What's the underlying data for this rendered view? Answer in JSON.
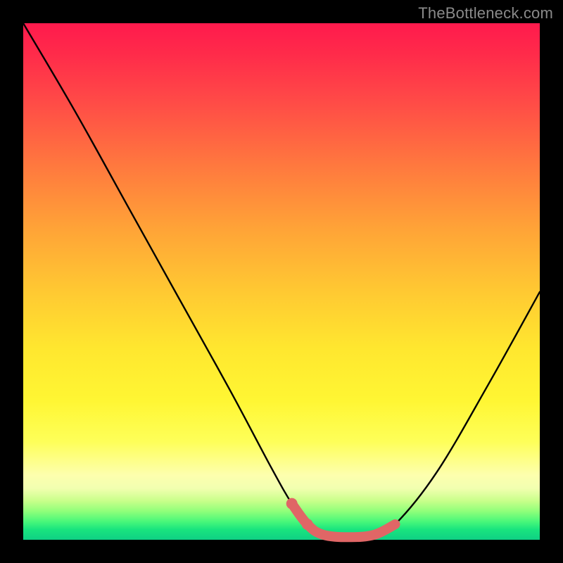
{
  "watermark": "TheBottleneck.com",
  "chart_data": {
    "type": "line",
    "title": "",
    "xlabel": "",
    "ylabel": "",
    "xlim": [
      0,
      100
    ],
    "ylim": [
      0,
      100
    ],
    "grid": false,
    "legend": false,
    "series": [
      {
        "name": "bottleneck-curve",
        "color": "#000000",
        "x": [
          0,
          10,
          20,
          30,
          40,
          48,
          52,
          55,
          58,
          63,
          68,
          72,
          80,
          90,
          100
        ],
        "values": [
          100,
          83,
          65,
          47,
          29,
          14,
          7,
          3,
          1,
          0.5,
          1,
          3,
          13,
          30,
          48
        ]
      },
      {
        "name": "highlight-segment",
        "color": "#e06666",
        "x": [
          52,
          55,
          58,
          63,
          68,
          72
        ],
        "values": [
          7,
          3,
          1,
          0.5,
          1,
          3
        ]
      }
    ],
    "annotations": [
      {
        "name": "highlight-dot-a",
        "x": 52,
        "y": 7,
        "r": 1.0,
        "color": "#e06666"
      },
      {
        "name": "highlight-dot-b",
        "x": 55,
        "y": 3,
        "r": 1.0,
        "color": "#e06666"
      }
    ]
  }
}
